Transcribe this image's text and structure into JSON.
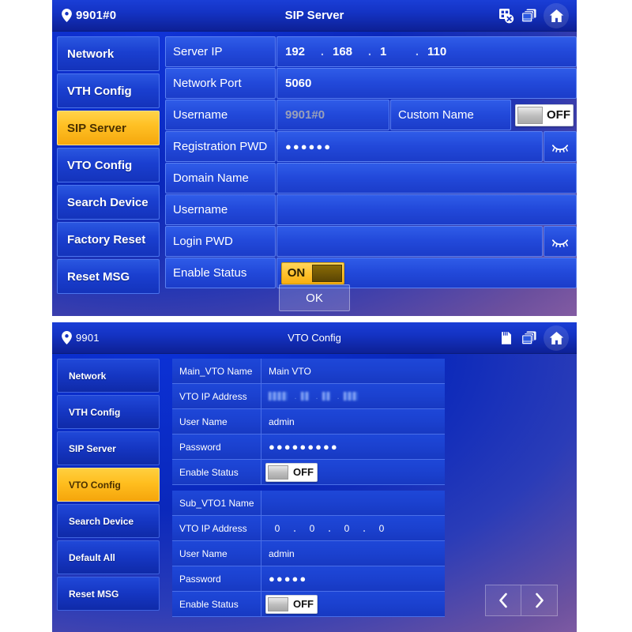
{
  "top_panel": {
    "titlebar": {
      "device_id": "9901#0",
      "title": "SIP Server",
      "icons": [
        "sip-disconnected-icon",
        "screens-icon",
        "home-icon"
      ]
    },
    "sidebar": {
      "items": [
        {
          "label": "Network",
          "active": false
        },
        {
          "label": "VTH Config",
          "active": false
        },
        {
          "label": "SIP Server",
          "active": true
        },
        {
          "label": "VTO Config",
          "active": false
        },
        {
          "label": "Search Device",
          "active": false
        },
        {
          "label": "Factory Reset",
          "active": false
        },
        {
          "label": "Reset MSG",
          "active": false
        }
      ]
    },
    "form": {
      "server_ip": {
        "label": "Server IP",
        "octets": [
          "192",
          "168",
          "1",
          "110"
        ]
      },
      "network_port": {
        "label": "Network Port",
        "value": "5060"
      },
      "username": {
        "label": "Username",
        "value": "9901#0",
        "custom_name_label": "Custom Name",
        "custom_name_toggle": "OFF"
      },
      "registration_pwd": {
        "label": "Registration PWD",
        "value": "●●●●●●",
        "eye": "eye-closed-icon"
      },
      "domain_name": {
        "label": "Domain Name",
        "value": ""
      },
      "username2": {
        "label": "Username",
        "value": ""
      },
      "login_pwd": {
        "label": "Login PWD",
        "value": "",
        "eye": "eye-closed-icon"
      },
      "enable_status": {
        "label": "Enable Status",
        "toggle": "ON"
      }
    },
    "ok_label": "OK"
  },
  "bottom_panel": {
    "titlebar": {
      "device_id": "9901",
      "title": "VTO Config",
      "icons": [
        "sd-card-icon",
        "screens-icon",
        "home-icon"
      ]
    },
    "sidebar": {
      "items": [
        {
          "label": "Network",
          "active": false
        },
        {
          "label": "VTH Config",
          "active": false
        },
        {
          "label": "SIP Server",
          "active": false
        },
        {
          "label": "VTO Config",
          "active": true
        },
        {
          "label": "Search Device",
          "active": false
        },
        {
          "label": "Default All",
          "active": false
        },
        {
          "label": "Reset MSG",
          "active": false
        }
      ]
    },
    "main_vto": {
      "name": {
        "label": "Main_VTO Name",
        "value": "Main VTO"
      },
      "ip": {
        "label": "VTO IP Address",
        "value": "",
        "redacted": true
      },
      "user": {
        "label": "User Name",
        "value": "admin"
      },
      "password": {
        "label": "Password",
        "value": "●●●●●●●●●"
      },
      "enable": {
        "label": "Enable Status",
        "toggle": "OFF"
      }
    },
    "sub_vto1": {
      "name": {
        "label": "Sub_VTO1 Name",
        "value": ""
      },
      "ip": {
        "label": "VTO IP Address",
        "octets": [
          "0",
          "0",
          "0",
          "0"
        ]
      },
      "user": {
        "label": "User Name",
        "value": "admin"
      },
      "password": {
        "label": "Password",
        "value": "●●●●●"
      },
      "enable": {
        "label": "Enable Status",
        "toggle": "OFF"
      }
    },
    "pager": {
      "prev": "chevron-left-icon",
      "next": "chevron-right-icon"
    }
  },
  "colors": {
    "accent_yellow": "#ffbf28",
    "panel_blue": "#1433c4",
    "field_blue": "#2249da",
    "title_blue": "#0d2095"
  }
}
